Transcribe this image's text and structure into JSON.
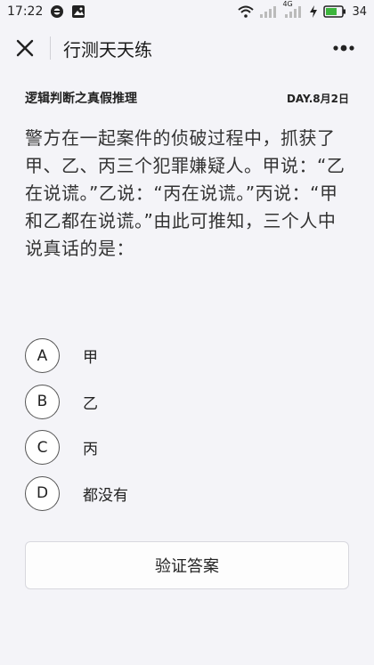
{
  "status_bar": {
    "time": "17:22",
    "battery_level": "34",
    "network_label": "4G"
  },
  "nav": {
    "title": "行测天天练"
  },
  "meta": {
    "category": "逻辑判断之真假推理",
    "day": "DAY.8月2日"
  },
  "question": {
    "text": "警方在一起案件的侦破过程中，抓获了甲、乙、丙三个犯罪嫌疑人。甲说：“乙在说谎。”乙说：“丙在说谎。”丙说：“甲和乙都在说谎。”由此可推知，三个人中说真话的是："
  },
  "options": [
    {
      "letter": "A",
      "text": "甲"
    },
    {
      "letter": "B",
      "text": "乙"
    },
    {
      "letter": "C",
      "text": "丙"
    },
    {
      "letter": "D",
      "text": "都没有"
    }
  ],
  "actions": {
    "verify_label": "验证答案"
  },
  "colors": {
    "background": "#f4f4f8",
    "text": "#222222",
    "question_text": "#333333"
  }
}
